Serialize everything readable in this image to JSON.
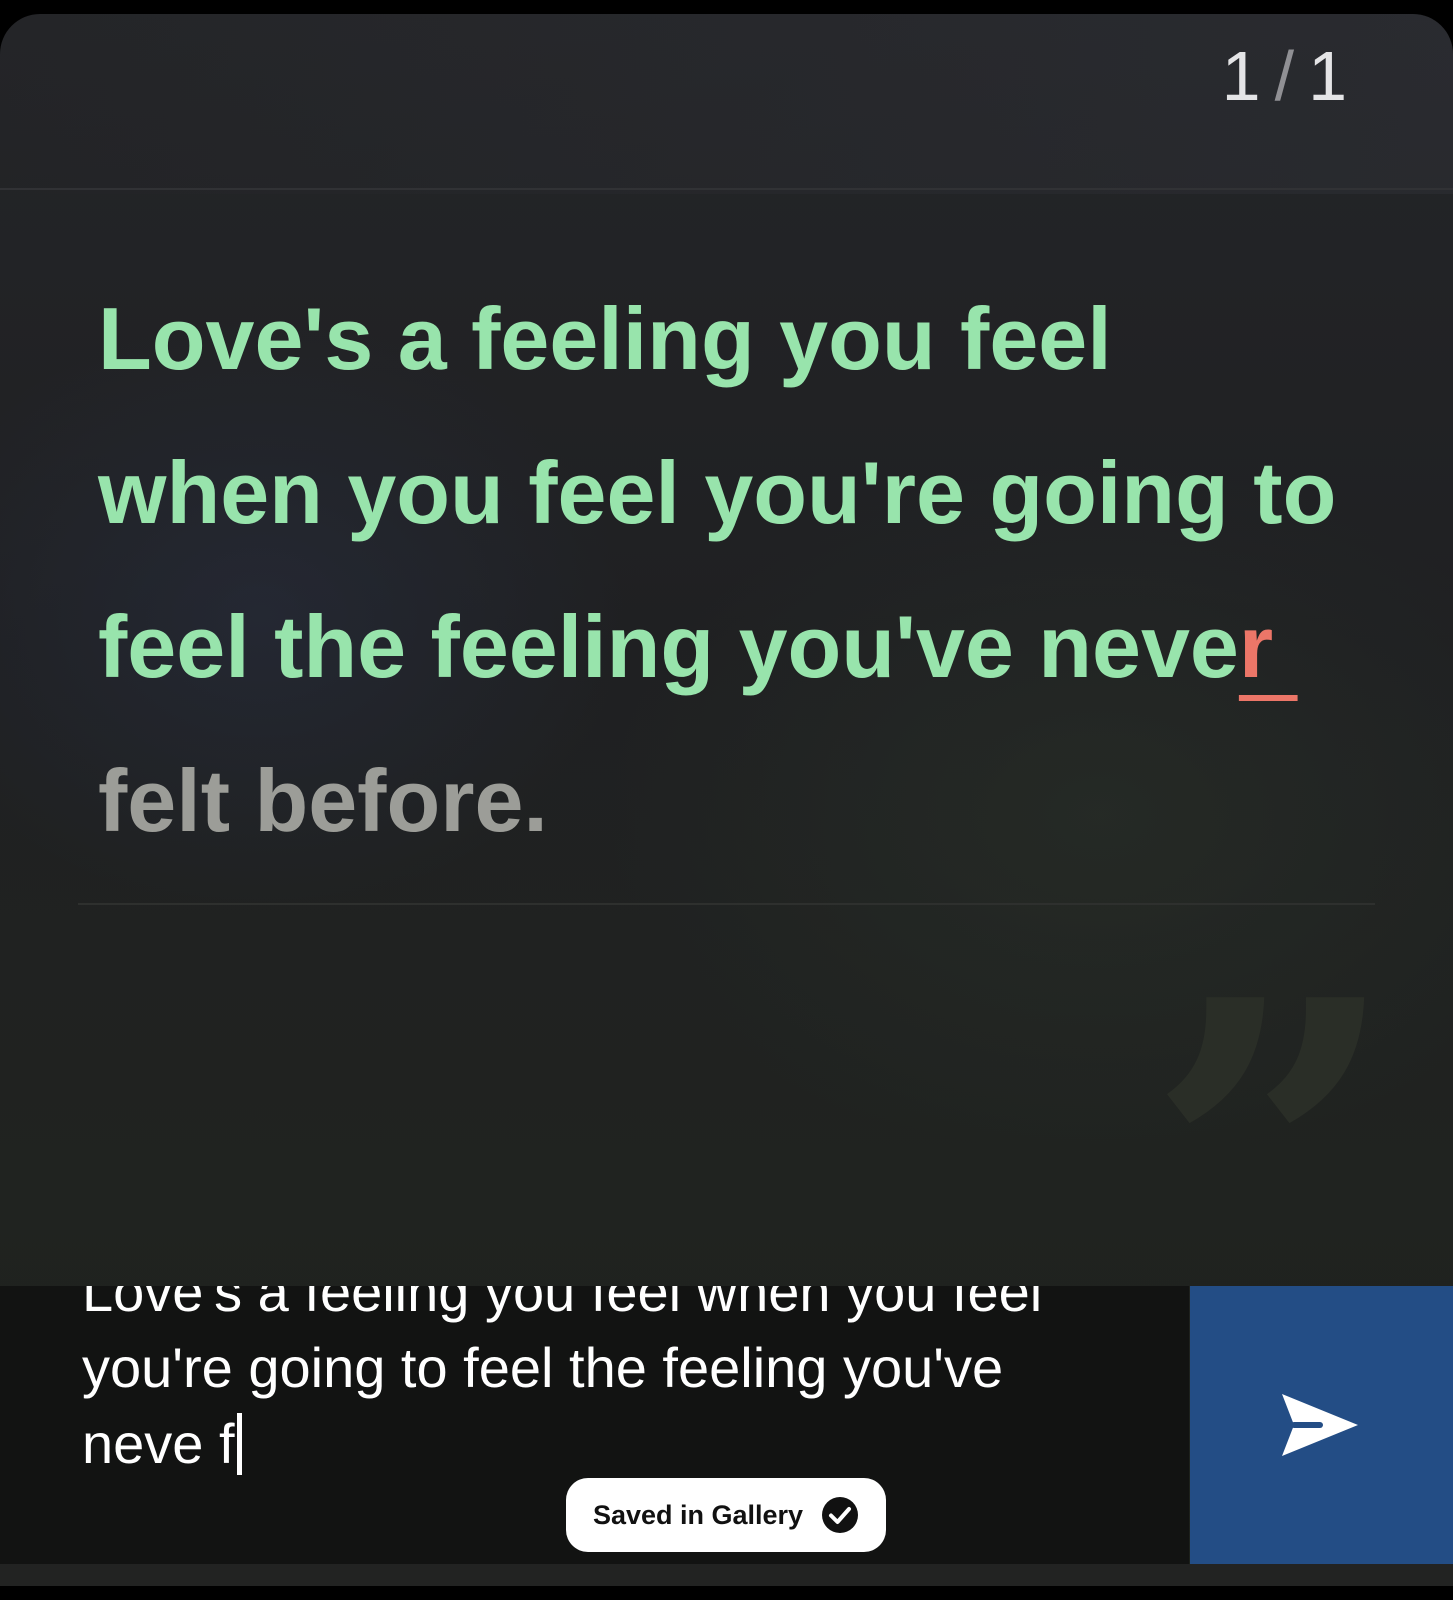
{
  "counter": {
    "current": "1",
    "separator": "/",
    "total": "1"
  },
  "quote": {
    "correct_text": "Love's a feeling you feel when you feel you're going to feel the feeling you've neve",
    "error_text": "r ",
    "remaining_text": "felt before."
  },
  "input": {
    "typed_text": "Love's a feeling you feel when you feel you're going to feel the feeling you've neve f"
  },
  "toast": {
    "label": "Saved in Gallery"
  },
  "icons": {
    "send": "send-arrow-icon",
    "toast": "check-circle-icon",
    "decoration": "closing-quote-icon"
  },
  "colors": {
    "correct": "#98e4ac",
    "error": "#ec7668",
    "remaining": "#9c9d98",
    "send_button": "#234d85"
  }
}
